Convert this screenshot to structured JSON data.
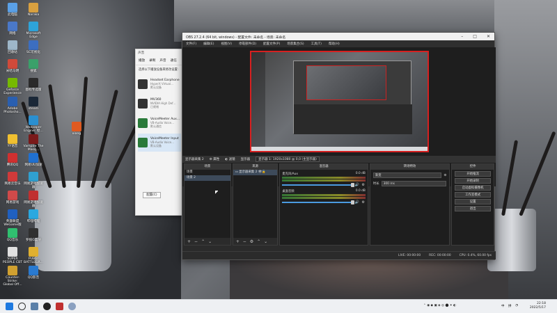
{
  "desktop": {
    "icons": [
      {
        "label": "此电脑",
        "color": "#5aa0e6"
      },
      {
        "label": "Naraka",
        "color": "#d8a040"
      },
      {
        "label": "网络",
        "color": "#4a78c8"
      },
      {
        "label": "Microsoft Edge",
        "color": "#2ea3d9"
      },
      {
        "label": "回收站",
        "color": "#9eb7c9"
      },
      {
        "label": "SC可视化",
        "color": "#3c6ec0"
      },
      {
        "label": "米哈马明",
        "color": "#d04a3a"
      },
      {
        "label": "搜狐",
        "color": "#3aa06a"
      },
      {
        "label": "Geforce Experience",
        "color": "#76b900"
      },
      {
        "label": "图标专选版",
        "color": "#2a2a2a"
      },
      {
        "label": "Adobe Photosho...",
        "color": "#2a5fb0"
      },
      {
        "label": "steam",
        "color": "#1b2838"
      },
      {
        "label": "xiang",
        "color": "#e05a20"
      },
      {
        "label": "Wallpaper Engine: 壁...",
        "color": "#2a8fd0"
      },
      {
        "label": "YY语音",
        "color": "#f0c030"
      },
      {
        "label": "Vampire The Masq...",
        "color": "#7a1a1a"
      },
      {
        "label": "腾讯QQ",
        "color": "#d03030"
      },
      {
        "label": "网易UU加速",
        "color": "#2070d0"
      },
      {
        "label": "网易云音乐",
        "color": "#d03a3a"
      },
      {
        "label": "网易游戏加速器",
        "color": "#30a0d0"
      },
      {
        "label": "网易游戏",
        "color": "#d04a4a"
      },
      {
        "label": "网易游戏加速器",
        "color": "#c03030"
      },
      {
        "label": "英雄联盟 WeGame版",
        "color": "#2060c0"
      },
      {
        "label": "哔哩哔哩",
        "color": "#2aa8e0"
      },
      {
        "label": "QQ音乐",
        "color": "#30c070"
      },
      {
        "label": "罗技G蓝牙",
        "color": "#303030"
      },
      {
        "label": "SUPER PEOPLE CBT",
        "color": "#e0e0e0"
      },
      {
        "label": "PUBG: BATTLEGR...",
        "color": "#e0b030"
      },
      {
        "label": "Counter-Strike: Global Off...",
        "color": "#d0a030"
      },
      {
        "label": "QQ影音",
        "color": "#2a7ad0"
      }
    ]
  },
  "sound_window": {
    "title": "声音",
    "tabs": [
      "播放",
      "录制",
      "声音",
      "通信"
    ],
    "hint": "选择以下播放设备来修改设置:",
    "devices": [
      {
        "name": "Headset Earphone",
        "sub": "HyperX Virtual...",
        "sub2": "默认设备"
      },
      {
        "name": "MV360",
        "sub": "NVIDIA High Def...",
        "sub2": "已就绪"
      },
      {
        "name": "VoiceMeeter Aux...",
        "sub": "VB-Audio Voice...",
        "sub2": "默认通信"
      },
      {
        "name": "VoiceMeeter Input",
        "sub": "VB-Audio Voice...",
        "sub2": "默认设备"
      }
    ],
    "configure_label": "配置(C)"
  },
  "obs": {
    "title": "OBS 27.2.4 (64 bit, windows) - 配置文件: 未命名 - 场景: 未命名",
    "menus": [
      "文件(F)",
      "编辑(E)",
      "视图(V)",
      "停靠部件(D)",
      "配置文件(P)",
      "场景集合(S)",
      "工具(T)",
      "帮助(H)"
    ],
    "context_bar": {
      "source": "显示器采集 2",
      "properties": "属性",
      "filters": "滤镜",
      "display_label": "显示器",
      "display_value": "显示器 1: 1920x1080 @ 0,0 (主显示器)"
    },
    "docks": {
      "scenes": {
        "header": "场景",
        "items": [
          "场景",
          "场景 2"
        ]
      },
      "sources": {
        "header": "来源",
        "items": [
          "显示器采集 2"
        ]
      },
      "mixer": {
        "header": "混音器",
        "channels": [
          {
            "name": "麦克风/Aux",
            "db": "0.0 dB"
          },
          {
            "name": "桌面音频",
            "db": "0.0 dB"
          }
        ]
      },
      "transitions": {
        "header": "转场特效",
        "type": "渐变",
        "duration_label": "时长",
        "duration": "300 ms"
      },
      "controls": {
        "header": "控件",
        "buttons": [
          "开始推流",
          "开始录制",
          "启动虚拟摄像机",
          "工作室模式",
          "设置",
          "退出"
        ]
      }
    },
    "status": {
      "live": "LIVE: 00:00:00",
      "rec": "REC: 00:00:00",
      "cpu": "CPU: 0.4%, 60.00 fps"
    }
  },
  "taskbar": {
    "clock_time": "22:18",
    "clock_date": "2022/5/17",
    "tray_lang": "中",
    "tray_app": "拼"
  },
  "colors": {
    "obs_bg": "#2b2b2b",
    "accent_red": "#d62020",
    "selection": "#3d4a5a"
  }
}
